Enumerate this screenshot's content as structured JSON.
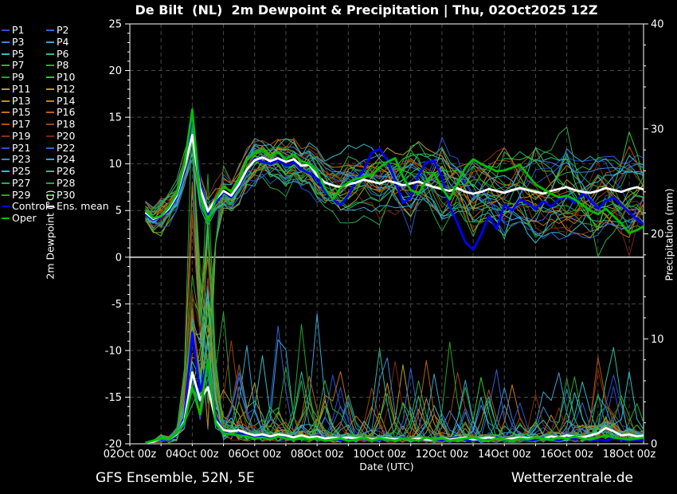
{
  "title": "De Bilt  (NL)  2m Dewpoint & Precipitation | Thu, 02Oct2025 12Z",
  "footer": {
    "left": "GFS Ensemble, 52N, 5E",
    "right": "Wetterzentrale.de"
  },
  "colors": {
    "background": "#000000",
    "grid": "#484848",
    "axis": "#ffffff",
    "zero_line": "#ffffff",
    "text": "#ffffff",
    "control": "#0000ff",
    "ens_mean": "#ffffff",
    "oper": "#00c000"
  },
  "legend": {
    "members": [
      {
        "label": "P1",
        "color": "#2a50cc"
      },
      {
        "label": "P2",
        "color": "#2f62d8"
      },
      {
        "label": "P3",
        "color": "#3a86d4"
      },
      {
        "label": "P4",
        "color": "#36a4d4"
      },
      {
        "label": "P5",
        "color": "#30bcc4"
      },
      {
        "label": "P6",
        "color": "#2eb896"
      },
      {
        "label": "P7",
        "color": "#2aae4e"
      },
      {
        "label": "P8",
        "color": "#28a83a"
      },
      {
        "label": "P9",
        "color": "#26a428"
      },
      {
        "label": "P10",
        "color": "#30c630"
      },
      {
        "label": "P11",
        "color": "#b0a426"
      },
      {
        "label": "P12",
        "color": "#bc9820"
      },
      {
        "label": "P13",
        "color": "#c48c1c"
      },
      {
        "label": "P14",
        "color": "#c47e18"
      },
      {
        "label": "P15",
        "color": "#c06f14"
      },
      {
        "label": "P16",
        "color": "#b86010"
      },
      {
        "label": "P17",
        "color": "#ac500e"
      },
      {
        "label": "P18",
        "color": "#9c400e"
      },
      {
        "label": "P19",
        "color": "#8c300e"
      },
      {
        "label": "P20",
        "color": "#7e2410"
      },
      {
        "label": "P21",
        "color": "#2a50cc"
      },
      {
        "label": "P22",
        "color": "#2f62d8"
      },
      {
        "label": "P23",
        "color": "#3a86d4"
      },
      {
        "label": "P24",
        "color": "#36a4d4"
      },
      {
        "label": "P25",
        "color": "#30bcc4"
      },
      {
        "label": "P26",
        "color": "#2eb896"
      },
      {
        "label": "P27",
        "color": "#2aae4e"
      },
      {
        "label": "P28",
        "color": "#28a83a"
      },
      {
        "label": "P29",
        "color": "#26a428"
      },
      {
        "label": "P30",
        "color": "#30c630"
      }
    ],
    "extra": [
      {
        "label": "Control",
        "color": "#0000ff"
      },
      {
        "label": "Ens. mean",
        "color": "#ffffff"
      },
      {
        "label": "Oper",
        "color": "#00c000"
      }
    ]
  },
  "chart_data": {
    "type": "line",
    "title": "De Bilt (NL) 2m Dewpoint & Precipitation | Thu, 02Oct2025 12Z",
    "x_axis": {
      "label": "Date (UTC)",
      "tick_labels": [
        "02Oct 00z",
        "04Oct 00z",
        "06Oct 00z",
        "08Oct 00z",
        "10Oct 00z",
        "12Oct 00z",
        "14Oct 00z",
        "16Oct 00z",
        "18Oct 00z"
      ],
      "tick_days": [
        0,
        2,
        4,
        6,
        8,
        10,
        12,
        14,
        16
      ],
      "range_days": [
        0,
        16.5
      ],
      "grid_every_days": 1
    },
    "y_axis_left": {
      "label": "2m Dewpoint (°C)",
      "ticks": [
        25,
        20,
        15,
        10,
        5,
        0,
        -5,
        -10,
        -15,
        -20
      ],
      "minor_step": 1,
      "range": [
        -20,
        25
      ]
    },
    "y_axis_right": {
      "label": "Precipitation (mm)",
      "ticks": [
        40,
        30,
        20,
        10,
        0
      ],
      "minor_step": 2,
      "range": [
        0,
        40
      ]
    },
    "start_hour": 12,
    "step_hours": 6,
    "end_hour": 396,
    "series": {
      "ens_mean_dewpoint": [
        4.8,
        4.1,
        4.4,
        5.2,
        6.6,
        9.6,
        13.1,
        7.4,
        4.9,
        6.2,
        7.1,
        6.6,
        7.8,
        9.4,
        10.4,
        10.7,
        10.3,
        10.6,
        10.2,
        10.5,
        9.8,
        9.9,
        8.8,
        8.0,
        7.7,
        7.5,
        7.8,
        8.0,
        8.3,
        8.1,
        7.9,
        8.2,
        8.0,
        7.7,
        7.9,
        8.1,
        7.8,
        7.5,
        7.3,
        7.1,
        7.4,
        7.0,
        6.8,
        7.0,
        7.3,
        7.1,
        6.9,
        7.2,
        7.4,
        7.2,
        7.0,
        6.8,
        7.1,
        7.3,
        7.5,
        7.2,
        7.0,
        6.9,
        7.1,
        7.4,
        7.2,
        7.0,
        7.3,
        7.5,
        7.2
      ],
      "control_dewpoint": [
        4.6,
        4.0,
        4.3,
        5.0,
        6.4,
        9.2,
        15.3,
        8.0,
        4.6,
        5.8,
        7.0,
        6.4,
        7.6,
        9.2,
        10.6,
        10.2,
        10.0,
        10.4,
        9.8,
        10.2,
        9.4,
        9.0,
        8.4,
        7.0,
        6.2,
        5.6,
        6.6,
        8.2,
        9.4,
        11.2,
        11.6,
        10.4,
        8.2,
        5.8,
        6.4,
        8.8,
        10.2,
        10.3,
        8.6,
        5.4,
        3.6,
        1.6,
        0.8,
        2.4,
        4.4,
        3.0,
        5.6,
        5.0,
        6.2,
        5.8,
        5.2,
        6.0,
        5.4,
        6.2,
        6.6,
        5.8,
        6.8,
        6.2,
        5.2,
        6.0,
        6.4,
        5.6,
        4.8,
        4.0,
        3.4
      ],
      "oper_dewpoint": [
        5.0,
        4.2,
        4.4,
        5.4,
        6.8,
        10.0,
        15.8,
        6.5,
        3.8,
        6.2,
        7.6,
        7.0,
        8.4,
        10.4,
        11.2,
        11.6,
        10.8,
        11.3,
        10.5,
        11.0,
        10.3,
        10.0,
        9.2,
        7.4,
        6.2,
        7.4,
        8.0,
        8.4,
        8.6,
        8.8,
        9.6,
        10.2,
        10.6,
        8.6,
        7.2,
        6.8,
        8.2,
        9.0,
        7.4,
        6.2,
        8.0,
        9.6,
        10.5,
        10.0,
        9.6,
        9.2,
        9.3,
        9.6,
        9.9,
        8.8,
        7.8,
        7.3,
        6.8,
        6.4,
        6.6,
        6.2,
        5.6,
        5.0,
        4.6,
        5.2,
        4.4,
        3.6,
        2.6,
        2.9,
        3.4
      ],
      "ens_mean_precip": [
        0.1,
        0.2,
        0.5,
        0.4,
        0.9,
        2.2,
        6.8,
        4.2,
        5.4,
        2.2,
        1.3,
        1.2,
        1.3,
        1.0,
        0.8,
        0.9,
        0.7,
        0.9,
        0.8,
        0.6,
        0.8,
        0.6,
        0.7,
        0.5,
        0.6,
        0.5,
        0.6,
        0.5,
        0.6,
        0.4,
        0.5,
        0.5,
        0.4,
        0.5,
        0.4,
        0.5,
        0.4,
        0.4,
        0.5,
        0.4,
        0.5,
        0.6,
        0.4,
        0.5,
        0.6,
        0.5,
        0.4,
        0.5,
        0.6,
        0.5,
        0.6,
        0.5,
        0.7,
        0.6,
        0.8,
        0.7,
        0.6,
        0.8,
        1.0,
        1.5,
        1.2,
        0.8,
        0.9,
        0.7,
        0.8
      ],
      "control_precip": [
        0.1,
        0.2,
        0.4,
        0.3,
        0.8,
        2.5,
        10.6,
        5.0,
        7.8,
        2.6,
        1.2,
        0.8,
        1.0,
        0.8,
        0.6,
        0.7,
        0.5,
        0.8,
        0.6,
        0.4,
        0.7,
        0.5,
        0.8,
        0.4,
        0.6,
        0.3,
        0.5,
        0.4,
        0.6,
        0.3,
        0.4,
        0.5,
        0.3,
        0.6,
        0.4,
        0.3,
        0.5,
        0.4,
        0.3,
        0.5,
        0.6,
        0.4,
        0.3,
        0.5,
        0.4,
        0.6,
        0.3,
        0.4,
        0.5,
        0.3,
        0.4,
        0.6,
        0.5,
        0.3,
        0.6,
        0.4,
        0.5,
        0.3,
        0.4,
        0.3,
        0.5,
        0.4,
        0.3,
        0.4,
        0.3
      ],
      "oper_precip": [
        0.1,
        0.3,
        0.5,
        0.4,
        1.0,
        2.0,
        5.4,
        2.8,
        8.0,
        2.0,
        1.0,
        0.9,
        0.8,
        0.7,
        0.5,
        0.6,
        0.4,
        0.7,
        0.5,
        0.4,
        0.6,
        0.4,
        0.5,
        0.3,
        0.4,
        0.5,
        0.3,
        0.4,
        0.6,
        0.3,
        0.5,
        0.4,
        0.3,
        0.5,
        0.4,
        0.3,
        0.6,
        0.4,
        0.5,
        0.3,
        0.4,
        0.5,
        0.6,
        0.4,
        0.3,
        0.5,
        0.4,
        0.3,
        0.5,
        0.4,
        0.6,
        0.5,
        0.4,
        0.6,
        0.5,
        0.7,
        0.5,
        0.4,
        0.6,
        0.8,
        0.6,
        0.5,
        0.4,
        0.5,
        0.6
      ]
    },
    "members": {
      "count": 30,
      "labels": [
        "P1",
        "P2",
        "P3",
        "P4",
        "P5",
        "P6",
        "P7",
        "P8",
        "P9",
        "P10",
        "P11",
        "P12",
        "P13",
        "P14",
        "P15",
        "P16",
        "P17",
        "P18",
        "P19",
        "P20",
        "P21",
        "P22",
        "P23",
        "P24",
        "P25",
        "P26",
        "P27",
        "P28",
        "P29",
        "P30"
      ],
      "colors": [
        "#2a50cc",
        "#2f62d8",
        "#3a86d4",
        "#36a4d4",
        "#30bcc4",
        "#2eb896",
        "#2aae4e",
        "#28a83a",
        "#26a428",
        "#30c630",
        "#b0a426",
        "#bc9820",
        "#c48c1c",
        "#c47e18",
        "#c06f14",
        "#b86010",
        "#ac500e",
        "#9c400e",
        "#8c300e",
        "#7e2410",
        "#2a50cc",
        "#2f62d8",
        "#3a86d4",
        "#36a4d4",
        "#30bcc4",
        "#2eb896",
        "#2aae4e",
        "#28a83a",
        "#26a428",
        "#30c630"
      ],
      "seeds": [
        7,
        13,
        21,
        34,
        42,
        55,
        61,
        73,
        88,
        91,
        104,
        117,
        123,
        131,
        149,
        152,
        166,
        178,
        185,
        197,
        203,
        211,
        228,
        236,
        247,
        259,
        262,
        274,
        281,
        296
      ],
      "spread": {
        "start": 1.1,
        "growth": 3.9,
        "exp": 0.85
      },
      "crash_probability": 0.27,
      "crash_depth_range": [
        -19,
        -4
      ],
      "event_peak": {
        "min": 2,
        "scale": 28,
        "exp": 2.2
      }
    }
  }
}
